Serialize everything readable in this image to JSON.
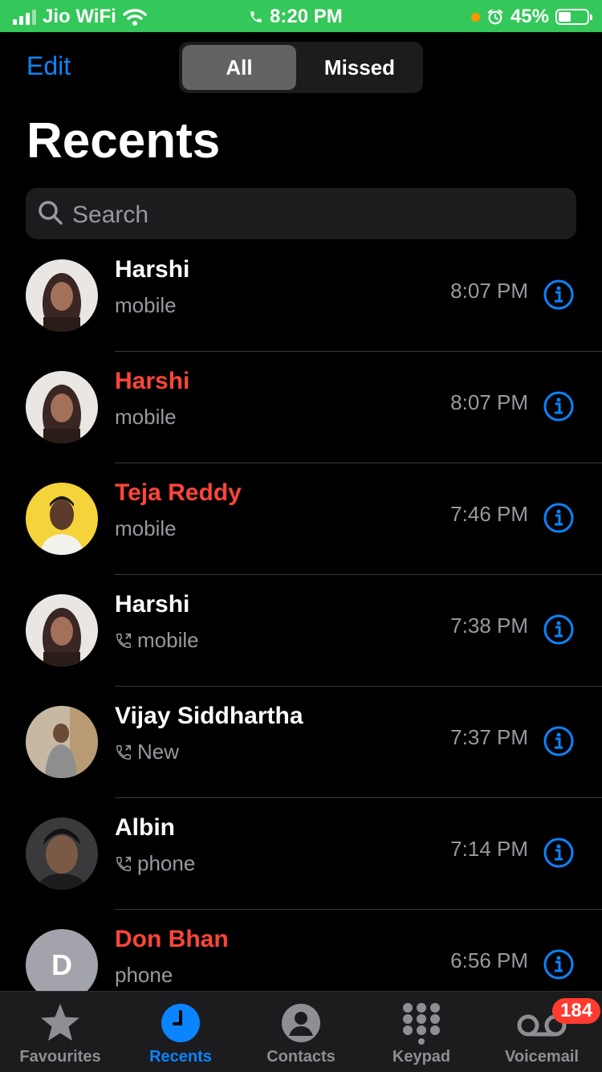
{
  "status_bar": {
    "carrier": "Jio WiFi",
    "time": "8:20 PM",
    "battery": "45%",
    "battery_level": 0.45,
    "icons": [
      "signal-icon",
      "wifi-icon",
      "phone-icon",
      "orange-dot",
      "alarm-icon",
      "battery-icon"
    ]
  },
  "header": {
    "edit_label": "Edit",
    "segments": [
      "All",
      "Missed"
    ],
    "selected_segment": "All",
    "title": "Recents"
  },
  "search": {
    "placeholder": "Search"
  },
  "calls": [
    {
      "name": "Harshi",
      "type": "mobile",
      "time": "8:07 PM",
      "missed": false,
      "outgoing": false,
      "avatar": "photo"
    },
    {
      "name": "Harshi",
      "type": "mobile",
      "time": "8:07 PM",
      "missed": true,
      "outgoing": false,
      "avatar": "photo"
    },
    {
      "name": "Teja Reddy",
      "type": "mobile",
      "time": "7:46 PM",
      "missed": true,
      "outgoing": false,
      "avatar": "photo"
    },
    {
      "name": "Harshi",
      "type": "mobile",
      "time": "7:38 PM",
      "missed": false,
      "outgoing": true,
      "avatar": "photo"
    },
    {
      "name": "Vijay Siddhartha",
      "type": "New",
      "time": "7:37 PM",
      "missed": false,
      "outgoing": true,
      "avatar": "photo"
    },
    {
      "name": "Albin",
      "type": "phone",
      "time": "7:14 PM",
      "missed": false,
      "outgoing": true,
      "avatar": "photo"
    },
    {
      "name": "Don Bhan",
      "type": "phone",
      "time": "6:56 PM",
      "missed": true,
      "outgoing": false,
      "avatar": "initial",
      "initial": "D"
    }
  ],
  "tabbar": {
    "tabs": [
      {
        "label": "Favourites",
        "icon": "star-icon"
      },
      {
        "label": "Recents",
        "icon": "clock-icon"
      },
      {
        "label": "Contacts",
        "icon": "person-icon"
      },
      {
        "label": "Keypad",
        "icon": "keypad-icon"
      },
      {
        "label": "Voicemail",
        "icon": "voicemail-icon"
      }
    ],
    "active": "Recents",
    "voicemail_badge": "184"
  },
  "colors": {
    "accent": "#0a84ff",
    "missed": "#ff453a",
    "status_bar": "#34c759",
    "badge": "#ff3b30"
  }
}
